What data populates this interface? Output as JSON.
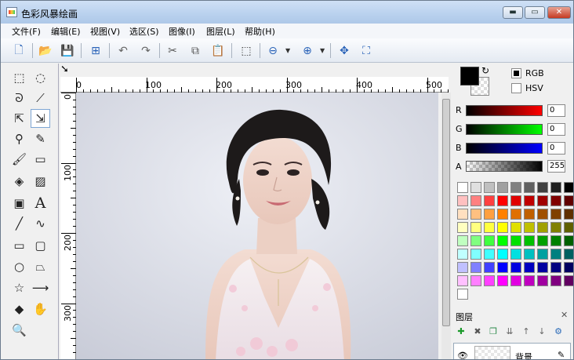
{
  "window": {
    "title": "色彩风暴绘画",
    "min_icon": "minimize-icon",
    "max_icon": "maximize-icon",
    "close_icon": "close-icon",
    "min_glyph": "▬",
    "max_glyph": "▭",
    "close_glyph": "✕"
  },
  "menu": [
    "文件(F)",
    "编辑(E)",
    "视图(V)",
    "选区(S)",
    "图像(I)",
    "图层(L)",
    "帮助(H)"
  ],
  "toolbar": {
    "icons": [
      "new-file-icon",
      "open-folder-icon",
      "save-icon",
      "resize-icon",
      "undo-icon",
      "redo-icon",
      "cut-icon",
      "copy-icon",
      "paste-icon",
      "deselect-icon",
      "zoom-out-icon",
      "zoom-in-icon",
      "fit-window-icon",
      "actual-size-icon"
    ],
    "glyphs": [
      "🗋",
      "📂",
      "💾",
      "⊞",
      "↶",
      "↷",
      "✂",
      "⧉",
      "📋",
      "⬚",
      "⊖",
      "⊕",
      "✥",
      "⛶"
    ]
  },
  "tools": {
    "icons": [
      "rect-select-icon",
      "ellipse-select-icon",
      "lasso-icon",
      "magic-wand-icon",
      "move-selection-icon",
      "move-pixels-icon",
      "color-picker-icon",
      "pencil-icon",
      "brush-icon",
      "eraser-icon",
      "paint-bucket-icon",
      "gradient-icon",
      "image-icon",
      "text-icon",
      "line-icon",
      "curve-icon",
      "rectangle-icon",
      "rounded-rect-icon",
      "ellipse-icon",
      "polygon-icon",
      "star-icon",
      "arrow-line-icon",
      "diamond-icon",
      "hand-icon",
      "zoom-icon"
    ],
    "glyphs": [
      "⬚",
      "◌",
      "ᘐ",
      "⟋",
      "⇱",
      "⇲",
      "⚲",
      "✎",
      "🖌",
      "▭",
      "◈",
      "▨",
      "▣",
      "A",
      "╱",
      "∿",
      "▭",
      "▢",
      "○",
      "⏢",
      "☆",
      "⟶",
      "◆",
      "✋",
      "🔍"
    ]
  },
  "ruler": {
    "top_labels": [
      "0",
      "100",
      "200",
      "300",
      "400",
      "500"
    ],
    "left_labels": [
      "0",
      "100",
      "200",
      "300"
    ]
  },
  "color_panel": {
    "rgb_label": "RGB",
    "hsv_label": "HSV",
    "rgb_checked": true,
    "hsv_checked": false,
    "swap_icon": "swap-colors-icon",
    "swap_glyph": "↻",
    "primary_color": "#000000",
    "secondary_color": "#ffffff",
    "channels": [
      {
        "label": "R",
        "value": "0",
        "gradient": "#ff0000"
      },
      {
        "label": "G",
        "value": "0",
        "gradient": "#00ff00"
      },
      {
        "label": "B",
        "value": "0",
        "gradient": "#0000ff"
      },
      {
        "label": "A",
        "value": "255",
        "gradient": "alpha"
      }
    ]
  },
  "palette": [
    [
      "#ffffff",
      "#e0e0e0",
      "#c0c0c0",
      "#a0a0a0",
      "#808080",
      "#606060",
      "#404040",
      "#202020",
      "#000000"
    ],
    [
      "#ffc0c0",
      "#ff8080",
      "#ff4040",
      "#ff0000",
      "#e00000",
      "#c00000",
      "#a00000",
      "#800000",
      "#600000"
    ],
    [
      "#ffe0c0",
      "#ffc080",
      "#ffa040",
      "#ff8000",
      "#e07000",
      "#c06000",
      "#a05000",
      "#804000",
      "#603000"
    ],
    [
      "#ffffc0",
      "#ffff80",
      "#ffff40",
      "#ffff00",
      "#e0e000",
      "#c0c000",
      "#a0a000",
      "#808000",
      "#606000"
    ],
    [
      "#c0ffc0",
      "#80ff80",
      "#40ff40",
      "#00ff00",
      "#00e000",
      "#00c000",
      "#00a000",
      "#008000",
      "#006000"
    ],
    [
      "#c0ffff",
      "#80ffff",
      "#40ffff",
      "#00ffff",
      "#00e0e0",
      "#00c0c0",
      "#00a0a0",
      "#008080",
      "#006060"
    ],
    [
      "#c0c0ff",
      "#8080ff",
      "#4040ff",
      "#0000ff",
      "#0000e0",
      "#0000c0",
      "#0000a0",
      "#000080",
      "#000060"
    ],
    [
      "#ffc0ff",
      "#ff80ff",
      "#ff40ff",
      "#ff00ff",
      "#e000e0",
      "#c000c0",
      "#a000a0",
      "#800080",
      "#600060"
    ],
    [
      "#ffffff"
    ]
  ],
  "layers": {
    "title": "图层",
    "close_glyph": "✕",
    "close_icon": "close-panel-icon",
    "buttons": [
      "add-layer-icon",
      "delete-layer-icon",
      "duplicate-layer-icon",
      "merge-layer-icon",
      "move-up-icon",
      "move-down-icon",
      "layer-properties-icon"
    ],
    "button_glyphs": [
      "✚",
      "✖",
      "❐",
      "⇊",
      "↑",
      "↓",
      "⚙"
    ],
    "items": [
      {
        "name": "背景",
        "visible_icon": "eye-icon",
        "edit_icon": "pencil-icon"
      }
    ]
  }
}
